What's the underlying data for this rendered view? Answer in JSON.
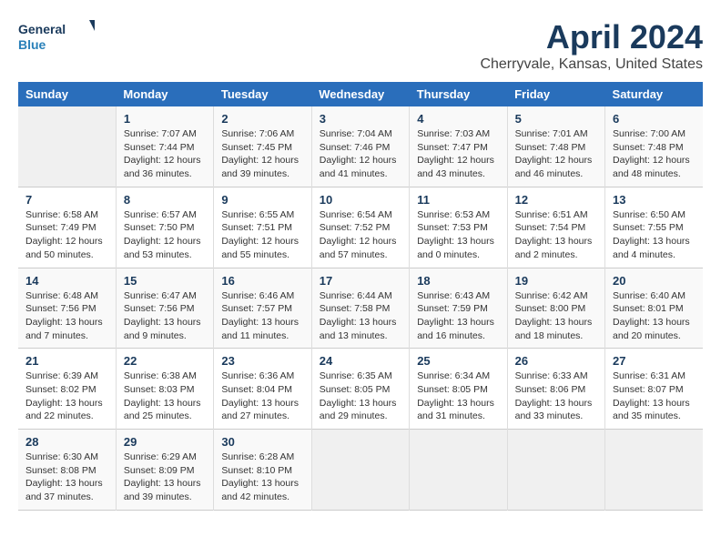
{
  "logo": {
    "line1": "General",
    "line2": "Blue"
  },
  "title": "April 2024",
  "subtitle": "Cherryvale, Kansas, United States",
  "weekdays": [
    "Sunday",
    "Monday",
    "Tuesday",
    "Wednesday",
    "Thursday",
    "Friday",
    "Saturday"
  ],
  "weeks": [
    [
      {
        "day": "",
        "sunrise": "",
        "sunset": "",
        "daylight": ""
      },
      {
        "day": "1",
        "sunrise": "Sunrise: 7:07 AM",
        "sunset": "Sunset: 7:44 PM",
        "daylight": "Daylight: 12 hours and 36 minutes."
      },
      {
        "day": "2",
        "sunrise": "Sunrise: 7:06 AM",
        "sunset": "Sunset: 7:45 PM",
        "daylight": "Daylight: 12 hours and 39 minutes."
      },
      {
        "day": "3",
        "sunrise": "Sunrise: 7:04 AM",
        "sunset": "Sunset: 7:46 PM",
        "daylight": "Daylight: 12 hours and 41 minutes."
      },
      {
        "day": "4",
        "sunrise": "Sunrise: 7:03 AM",
        "sunset": "Sunset: 7:47 PM",
        "daylight": "Daylight: 12 hours and 43 minutes."
      },
      {
        "day": "5",
        "sunrise": "Sunrise: 7:01 AM",
        "sunset": "Sunset: 7:48 PM",
        "daylight": "Daylight: 12 hours and 46 minutes."
      },
      {
        "day": "6",
        "sunrise": "Sunrise: 7:00 AM",
        "sunset": "Sunset: 7:48 PM",
        "daylight": "Daylight: 12 hours and 48 minutes."
      }
    ],
    [
      {
        "day": "7",
        "sunrise": "Sunrise: 6:58 AM",
        "sunset": "Sunset: 7:49 PM",
        "daylight": "Daylight: 12 hours and 50 minutes."
      },
      {
        "day": "8",
        "sunrise": "Sunrise: 6:57 AM",
        "sunset": "Sunset: 7:50 PM",
        "daylight": "Daylight: 12 hours and 53 minutes."
      },
      {
        "day": "9",
        "sunrise": "Sunrise: 6:55 AM",
        "sunset": "Sunset: 7:51 PM",
        "daylight": "Daylight: 12 hours and 55 minutes."
      },
      {
        "day": "10",
        "sunrise": "Sunrise: 6:54 AM",
        "sunset": "Sunset: 7:52 PM",
        "daylight": "Daylight: 12 hours and 57 minutes."
      },
      {
        "day": "11",
        "sunrise": "Sunrise: 6:53 AM",
        "sunset": "Sunset: 7:53 PM",
        "daylight": "Daylight: 13 hours and 0 minutes."
      },
      {
        "day": "12",
        "sunrise": "Sunrise: 6:51 AM",
        "sunset": "Sunset: 7:54 PM",
        "daylight": "Daylight: 13 hours and 2 minutes."
      },
      {
        "day": "13",
        "sunrise": "Sunrise: 6:50 AM",
        "sunset": "Sunset: 7:55 PM",
        "daylight": "Daylight: 13 hours and 4 minutes."
      }
    ],
    [
      {
        "day": "14",
        "sunrise": "Sunrise: 6:48 AM",
        "sunset": "Sunset: 7:56 PM",
        "daylight": "Daylight: 13 hours and 7 minutes."
      },
      {
        "day": "15",
        "sunrise": "Sunrise: 6:47 AM",
        "sunset": "Sunset: 7:56 PM",
        "daylight": "Daylight: 13 hours and 9 minutes."
      },
      {
        "day": "16",
        "sunrise": "Sunrise: 6:46 AM",
        "sunset": "Sunset: 7:57 PM",
        "daylight": "Daylight: 13 hours and 11 minutes."
      },
      {
        "day": "17",
        "sunrise": "Sunrise: 6:44 AM",
        "sunset": "Sunset: 7:58 PM",
        "daylight": "Daylight: 13 hours and 13 minutes."
      },
      {
        "day": "18",
        "sunrise": "Sunrise: 6:43 AM",
        "sunset": "Sunset: 7:59 PM",
        "daylight": "Daylight: 13 hours and 16 minutes."
      },
      {
        "day": "19",
        "sunrise": "Sunrise: 6:42 AM",
        "sunset": "Sunset: 8:00 PM",
        "daylight": "Daylight: 13 hours and 18 minutes."
      },
      {
        "day": "20",
        "sunrise": "Sunrise: 6:40 AM",
        "sunset": "Sunset: 8:01 PM",
        "daylight": "Daylight: 13 hours and 20 minutes."
      }
    ],
    [
      {
        "day": "21",
        "sunrise": "Sunrise: 6:39 AM",
        "sunset": "Sunset: 8:02 PM",
        "daylight": "Daylight: 13 hours and 22 minutes."
      },
      {
        "day": "22",
        "sunrise": "Sunrise: 6:38 AM",
        "sunset": "Sunset: 8:03 PM",
        "daylight": "Daylight: 13 hours and 25 minutes."
      },
      {
        "day": "23",
        "sunrise": "Sunrise: 6:36 AM",
        "sunset": "Sunset: 8:04 PM",
        "daylight": "Daylight: 13 hours and 27 minutes."
      },
      {
        "day": "24",
        "sunrise": "Sunrise: 6:35 AM",
        "sunset": "Sunset: 8:05 PM",
        "daylight": "Daylight: 13 hours and 29 minutes."
      },
      {
        "day": "25",
        "sunrise": "Sunrise: 6:34 AM",
        "sunset": "Sunset: 8:05 PM",
        "daylight": "Daylight: 13 hours and 31 minutes."
      },
      {
        "day": "26",
        "sunrise": "Sunrise: 6:33 AM",
        "sunset": "Sunset: 8:06 PM",
        "daylight": "Daylight: 13 hours and 33 minutes."
      },
      {
        "day": "27",
        "sunrise": "Sunrise: 6:31 AM",
        "sunset": "Sunset: 8:07 PM",
        "daylight": "Daylight: 13 hours and 35 minutes."
      }
    ],
    [
      {
        "day": "28",
        "sunrise": "Sunrise: 6:30 AM",
        "sunset": "Sunset: 8:08 PM",
        "daylight": "Daylight: 13 hours and 37 minutes."
      },
      {
        "day": "29",
        "sunrise": "Sunrise: 6:29 AM",
        "sunset": "Sunset: 8:09 PM",
        "daylight": "Daylight: 13 hours and 39 minutes."
      },
      {
        "day": "30",
        "sunrise": "Sunrise: 6:28 AM",
        "sunset": "Sunset: 8:10 PM",
        "daylight": "Daylight: 13 hours and 42 minutes."
      },
      {
        "day": "",
        "sunrise": "",
        "sunset": "",
        "daylight": ""
      },
      {
        "day": "",
        "sunrise": "",
        "sunset": "",
        "daylight": ""
      },
      {
        "day": "",
        "sunrise": "",
        "sunset": "",
        "daylight": ""
      },
      {
        "day": "",
        "sunrise": "",
        "sunset": "",
        "daylight": ""
      }
    ]
  ]
}
